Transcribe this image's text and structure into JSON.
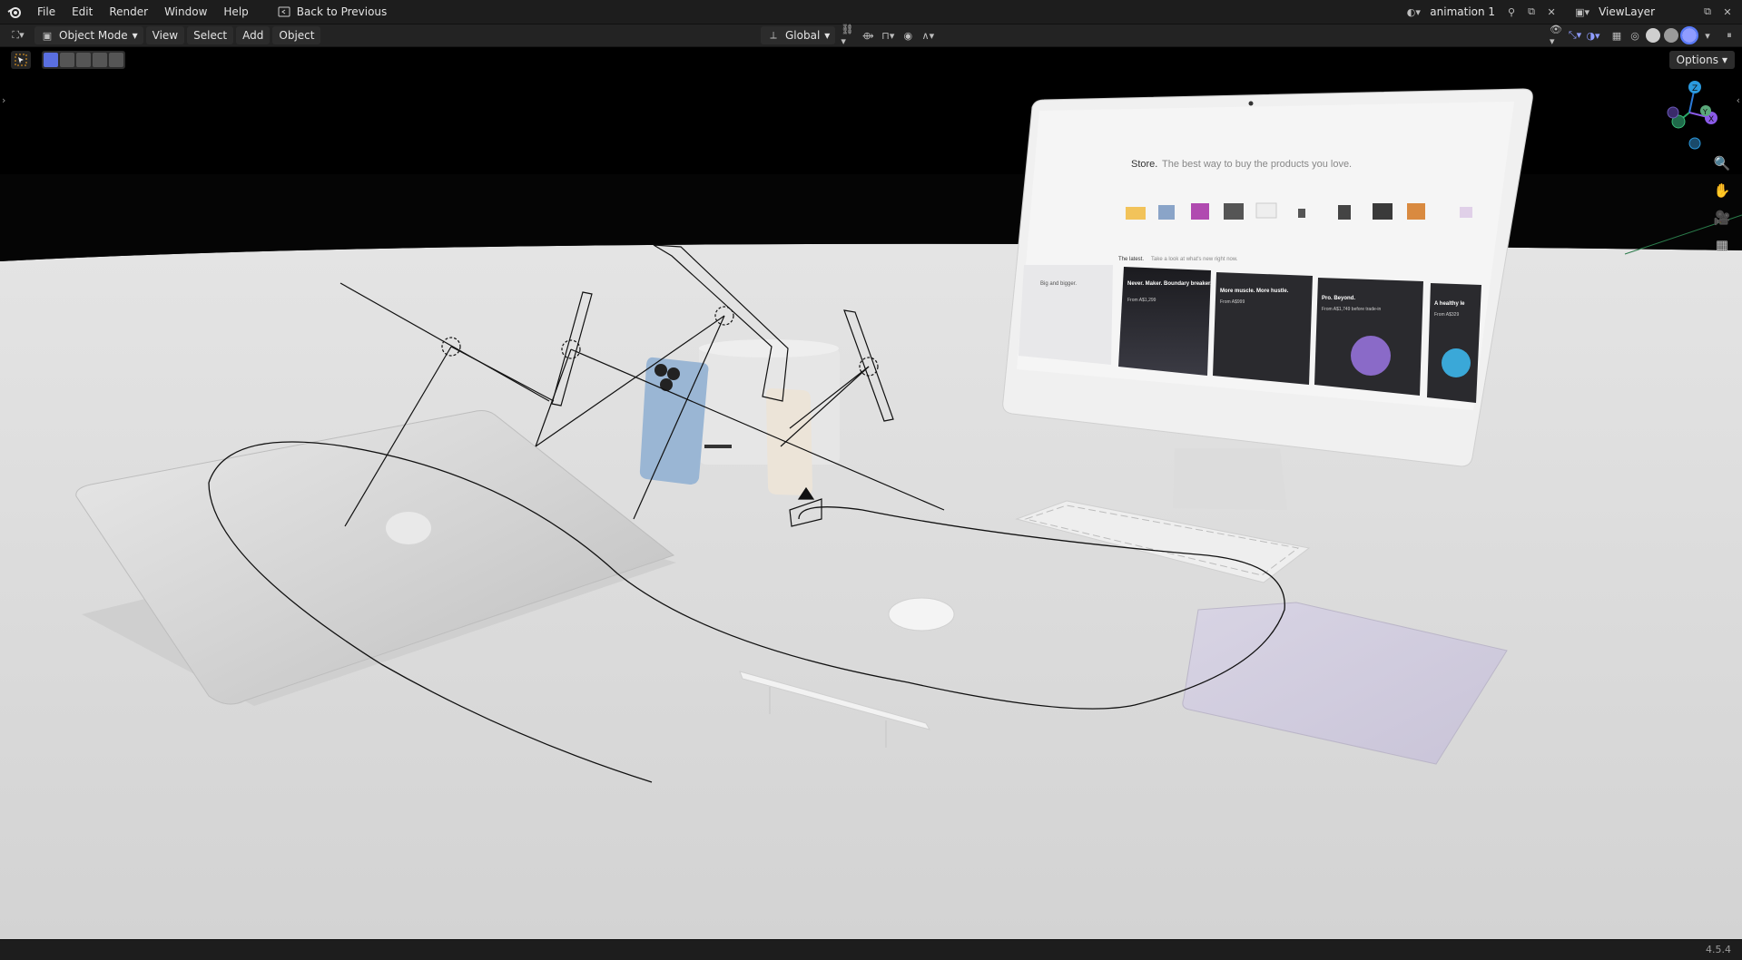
{
  "topbar": {
    "menus": [
      "File",
      "Edit",
      "Render",
      "Window",
      "Help"
    ],
    "back_button": "Back to Previous",
    "scene_name": "animation 1",
    "view_layer": "ViewLayer"
  },
  "header": {
    "mode": "Object Mode",
    "menus": [
      "View",
      "Select",
      "Add",
      "Object"
    ],
    "transform_orientation": "Global",
    "options_label": "Options"
  },
  "gizmo": {
    "axes": [
      "Z",
      "Y",
      "X"
    ]
  },
  "imac_screen": {
    "headline_strong": "Store.",
    "headline_rest": "The best way to buy the products you love.",
    "latest_heading": "The latest.",
    "latest_sub": "Take a look at what's new right now.",
    "cards": [
      {
        "title": "Never. Maker. Boundary breaker.",
        "price": "From A$1,299"
      },
      {
        "title": "More muscle. More hustle.",
        "price": "From A$999"
      },
      {
        "title": "Pro. Beyond.",
        "price": "From A$1,749 before trade-in"
      },
      {
        "title": "A healthy le",
        "price": "From A$329"
      }
    ],
    "first_card": "Big and bigger."
  },
  "status": {
    "version": "4.5.4"
  },
  "colors": {
    "accent": "#5a6fe0",
    "header_bg": "#1d1d1d",
    "viewport_floor": "#d9d9d9"
  }
}
